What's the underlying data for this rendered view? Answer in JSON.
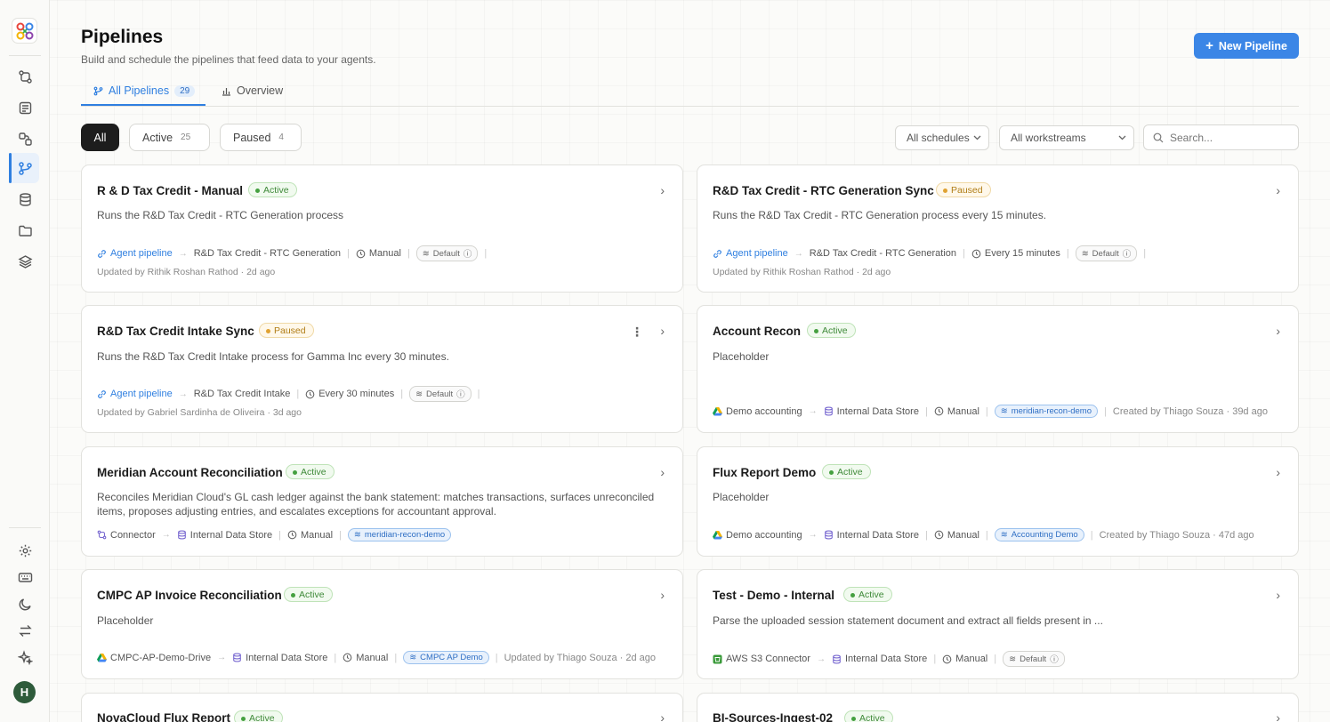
{
  "sidebar": {
    "nav": [
      "workflows-icon",
      "tasks-icon",
      "connectors-icon",
      "pipelines-icon",
      "database-icon",
      "folder-icon",
      "layers-icon"
    ],
    "bottom": [
      "settings-icon",
      "keyboard-icon",
      "theme-icon",
      "transfer-icon",
      "sparkle-icon"
    ],
    "avatar_initial": "H"
  },
  "header": {
    "title": "Pipelines",
    "subtitle": "Build and schedule the pipelines that feed data to your agents.",
    "new_button": "New Pipeline"
  },
  "tabs": [
    {
      "label": "All Pipelines",
      "count": "29"
    },
    {
      "label": "Overview"
    }
  ],
  "filters": {
    "all": "All",
    "active": "Active",
    "active_count": "25",
    "paused": "Paused",
    "paused_count": "4",
    "schedules": "All schedules",
    "workstreams": "All workstreams",
    "search_placeholder": "Search..."
  },
  "cards": [
    {
      "title": "R & D Tax Credit - Manual",
      "status": "Active",
      "desc": "Runs the R&D Tax Credit - RTC Generation process",
      "source": "Agent pipeline",
      "target": "R&D Tax Credit - RTC Generation",
      "schedule": "Manual",
      "tag": "Default",
      "updated": "Updated by Rithik Roshan Rathod · 2d ago"
    },
    {
      "title": "R&D Tax Credit - RTC Generation Sync",
      "status": "Paused",
      "desc": "Runs the R&D Tax Credit - RTC Generation process every 15 minutes.",
      "source": "Agent pipeline",
      "target": "R&D Tax Credit - RTC Generation",
      "schedule": "Every 15 minutes",
      "tag": "Default",
      "updated": "Updated by Rithik Roshan Rathod · 2d ago"
    },
    {
      "title": "R&D Tax Credit Intake Sync",
      "status": "Paused",
      "desc": "Runs the R&D Tax Credit Intake process for Gamma Inc every 30 minutes.",
      "source": "Agent pipeline",
      "target": "R&D Tax Credit Intake",
      "schedule": "Every 30 minutes",
      "tag": "Default",
      "updated": "Updated by Gabriel Sardinha de Oliveira · 3d ago"
    },
    {
      "title": "Account Recon",
      "status": "Active",
      "desc": "Placeholder",
      "source": "Demo accounting",
      "target": "Internal Data Store",
      "schedule": "Manual",
      "tag": "meridian-recon-demo",
      "updated": "Created by Thiago Souza · 39d ago"
    },
    {
      "title": "Meridian Account Reconciliation",
      "status": "Active",
      "desc": "Reconciles Meridian Cloud's GL cash ledger against the bank statement: matches transactions, surfaces unreconciled items, proposes adjusting entries, and escalates exceptions for accountant approval.",
      "source": "Connector",
      "target": "Internal Data Store",
      "schedule": "Manual",
      "tag": "meridian-recon-demo"
    },
    {
      "title": "Flux Report Demo",
      "status": "Active",
      "desc": "Placeholder",
      "source": "Demo accounting",
      "target": "Internal Data Store",
      "schedule": "Manual",
      "tag": "Accounting Demo",
      "updated": "Created by Thiago Souza · 47d ago"
    },
    {
      "title": "CMPC AP Invoice Reconciliation",
      "status": "Active",
      "desc": "Placeholder",
      "source": "CMPC-AP-Demo-Drive",
      "target": "Internal Data Store",
      "schedule": "Manual",
      "tag": "CMPC AP Demo",
      "updated": "Updated by Thiago Souza · 2d ago"
    },
    {
      "title": "Test - Demo - Internal",
      "status": "Active",
      "desc": "Parse the uploaded session statement document and extract all fields present in ...",
      "source": "AWS S3 Connector",
      "target": "Internal Data Store",
      "schedule": "Manual",
      "tag": "Default"
    },
    {
      "title": "NovaCloud Flux Report",
      "status": "Active"
    },
    {
      "title": "BI-Sources-Ingest-02",
      "status": "Active"
    }
  ],
  "colors": {
    "accent": "#3b86e6",
    "active": "#45a040",
    "paused": "#e0a232"
  }
}
